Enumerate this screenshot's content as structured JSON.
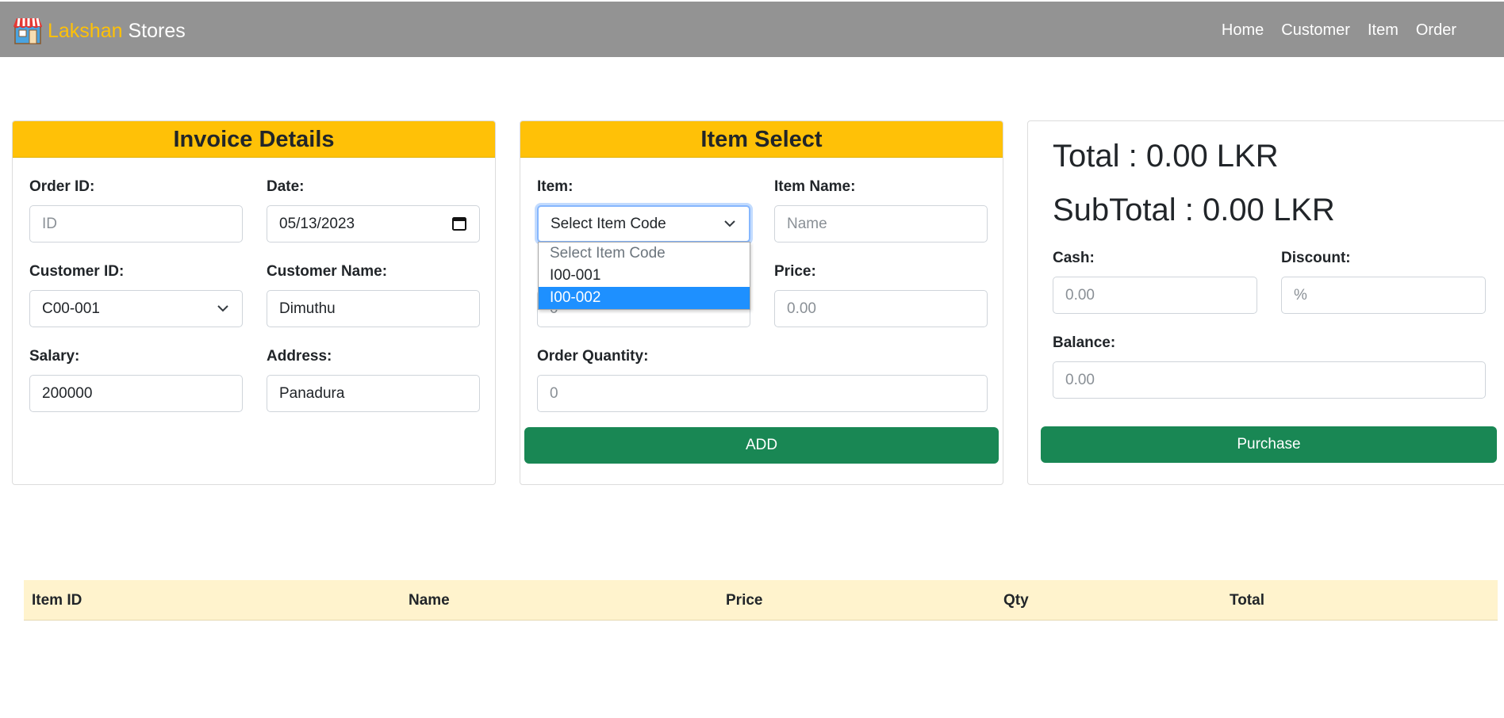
{
  "navbar": {
    "brand_first": "Lakshan",
    "brand_second": "Stores",
    "links": [
      "Home",
      "Customer",
      "Item",
      "Order"
    ]
  },
  "invoice": {
    "title": "Invoice Details",
    "order_id_label": "Order ID:",
    "order_id_placeholder": "ID",
    "date_label": "Date:",
    "date_value": "05/13/2023",
    "customer_id_label": "Customer ID:",
    "customer_id_value": "C00-001",
    "customer_name_label": "Customer Name:",
    "customer_name_value": "Dimuthu",
    "salary_label": "Salary:",
    "salary_value": "200000",
    "address_label": "Address:",
    "address_value": "Panadura"
  },
  "item_select": {
    "title": "Item Select",
    "item_label": "Item:",
    "item_value": "Select Item Code",
    "item_options": [
      "Select Item Code",
      "I00-001",
      "I00-002"
    ],
    "item_name_label": "Item Name:",
    "item_name_placeholder": "Name",
    "qty_on_hand_value": "0",
    "price_label": "Price:",
    "price_placeholder": "0.00",
    "order_qty_label": "Order Quantity:",
    "order_qty_placeholder": "0",
    "add_button": "ADD"
  },
  "summary": {
    "total": "Total : 0.00 LKR",
    "subtotal": "SubTotal : 0.00 LKR",
    "cash_label": "Cash:",
    "cash_placeholder": "0.00",
    "discount_label": "Discount:",
    "discount_placeholder": "%",
    "balance_label": "Balance:",
    "balance_placeholder": "0.00",
    "purchase_button": "Purchase"
  },
  "table": {
    "columns": [
      "Item ID",
      "Name",
      "Price",
      "Qty",
      "Total"
    ]
  },
  "colors": {
    "navbar": "#939393",
    "accent": "#ffc107",
    "button": "#198754",
    "table_header": "#fff3cd",
    "highlight": "#1e90ff"
  }
}
